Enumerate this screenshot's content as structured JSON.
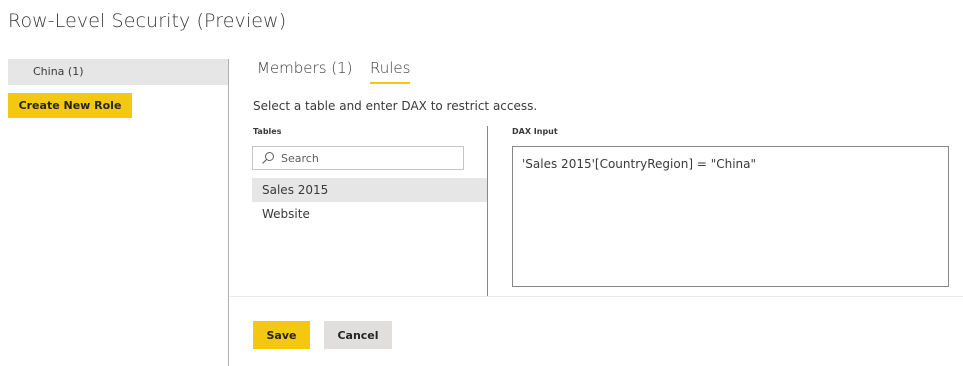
{
  "page": {
    "title": "Row-Level Security (Preview)"
  },
  "roles": {
    "items": [
      {
        "label": "China (1)"
      }
    ],
    "create_label": "Create New Role"
  },
  "tabs": [
    {
      "label": "Members (1)",
      "active": false
    },
    {
      "label": "Rules",
      "active": true
    }
  ],
  "rules": {
    "instructions": "Select a table and enter DAX to restrict access.",
    "tables_label": "Tables",
    "search_placeholder": "Search",
    "search_icon": "search-icon",
    "tables": [
      {
        "label": "Sales 2015",
        "selected": true
      },
      {
        "label": "Website",
        "selected": false
      }
    ],
    "dax_label": "DAX Input",
    "dax_value": "'Sales 2015'[CountryRegion] = \"China\""
  },
  "actions": {
    "save_label": "Save",
    "cancel_label": "Cancel"
  },
  "colors": {
    "accent": "#f2c811",
    "selected_bg": "#e6e6e6",
    "secondary_button": "#e1dfdd"
  }
}
